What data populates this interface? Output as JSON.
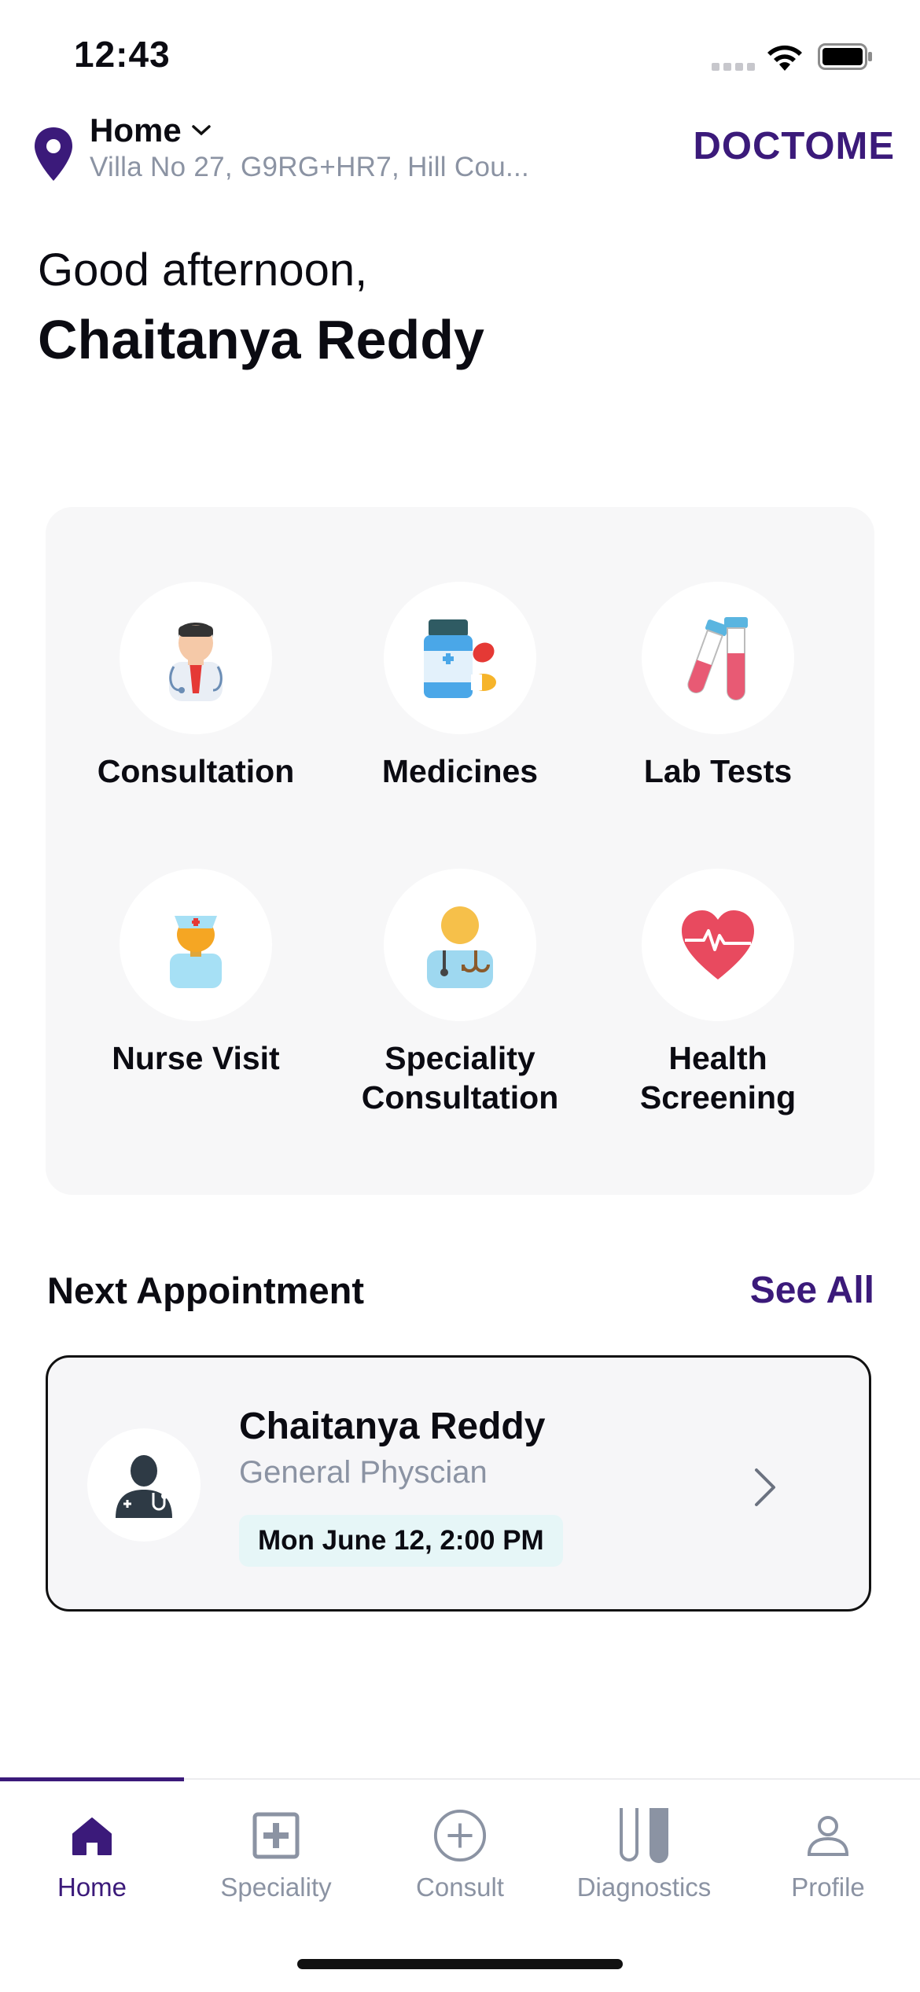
{
  "status_bar": {
    "time": "12:43"
  },
  "header": {
    "location_label": "Home",
    "address": "Villa No 27, G9RG+HR7, Hill Cou...",
    "brand": "DOCTOME"
  },
  "greeting": {
    "salutation": "Good afternoon,",
    "name": "Chaitanya Reddy"
  },
  "services": [
    {
      "label": "Consultation",
      "icon": "doctor-icon"
    },
    {
      "label": "Medicines",
      "icon": "medicine-bottle-icon"
    },
    {
      "label": "Lab Tests",
      "icon": "test-tubes-icon"
    },
    {
      "label": "Nurse Visit",
      "icon": "nurse-icon"
    },
    {
      "label": "Speciality Consultation",
      "icon": "specialist-icon"
    },
    {
      "label": "Health Screening",
      "icon": "heart-pulse-icon"
    }
  ],
  "appointment": {
    "section_title": "Next Appointment",
    "see_all": "See All",
    "doctor_name": "Chaitanya Reddy",
    "specialty": "General Physcian",
    "datetime": "Mon June 12, 2:00 PM"
  },
  "tabs": [
    {
      "label": "Home",
      "icon": "home-icon",
      "active": true
    },
    {
      "label": "Speciality",
      "icon": "medical-cross-icon",
      "active": false
    },
    {
      "label": "Consult",
      "icon": "plus-circle-icon",
      "active": false
    },
    {
      "label": "Diagnostics",
      "icon": "test-tube-icon",
      "active": false
    },
    {
      "label": "Profile",
      "icon": "person-icon",
      "active": false
    }
  ],
  "colors": {
    "brand": "#3b1a7a",
    "muted": "#8b93a3",
    "card_bg": "#f7f7f8",
    "date_chip": "#e6f6f7"
  }
}
